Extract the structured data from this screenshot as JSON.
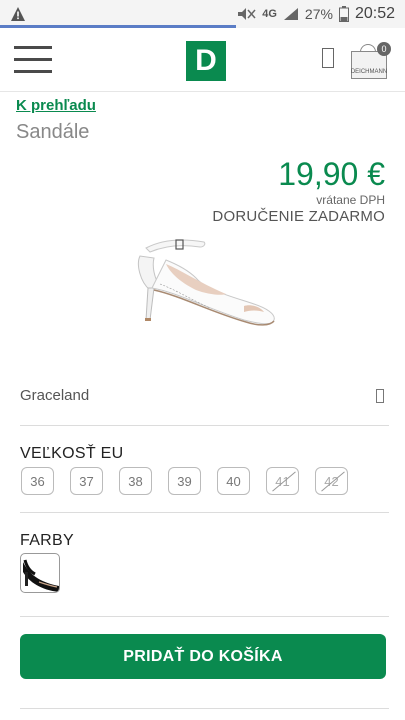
{
  "status_bar": {
    "network": "4G",
    "battery": "27%",
    "time": "20:52"
  },
  "header": {
    "logo_letter": "D",
    "cart_count": "0",
    "cart_brand": "DEICHMANN"
  },
  "product": {
    "back_link": "K prehľadu",
    "category": "Sandále",
    "price": "19,90 €",
    "vat_note": "vrátane DPH",
    "shipping": "DORUČENIE ZADARMO",
    "brand": "Graceland",
    "size_label": "VEĽKOSŤ EU",
    "sizes": [
      {
        "label": "36",
        "available": true
      },
      {
        "label": "37",
        "available": true
      },
      {
        "label": "38",
        "available": true
      },
      {
        "label": "39",
        "available": true
      },
      {
        "label": "40",
        "available": true
      },
      {
        "label": "41",
        "available": false
      },
      {
        "label": "42",
        "available": false
      }
    ],
    "colors_label": "FARBY",
    "add_to_cart": "PRIDAŤ DO KOŠÍKA"
  },
  "colors": {
    "accent": "#0a8a4f",
    "divider": "#dcdcdc"
  }
}
